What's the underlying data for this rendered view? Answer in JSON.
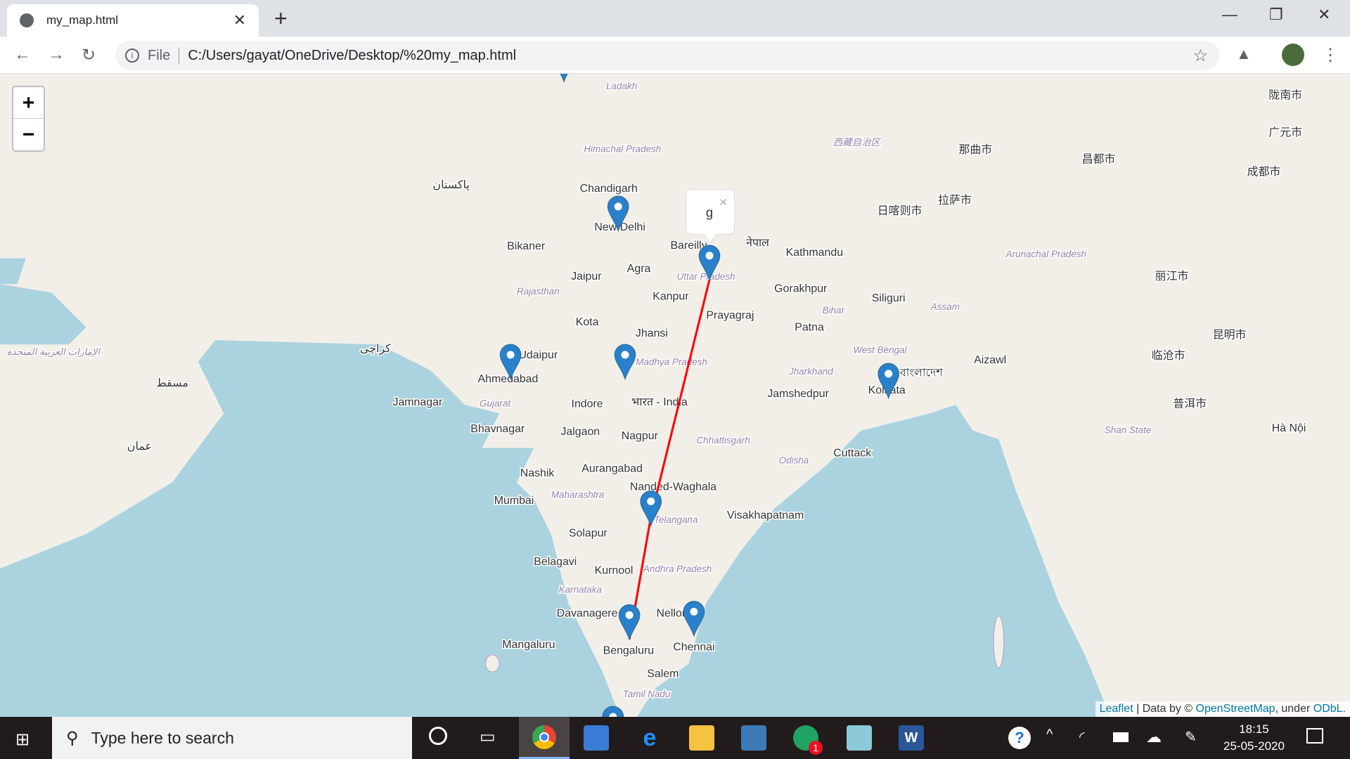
{
  "browser": {
    "tab_title": "my_map.html",
    "url_scheme": "File",
    "url": "C:/Users/gayat/OneDrive/Desktop/%20my_map.html"
  },
  "map": {
    "zoom_in": "+",
    "zoom_out": "−",
    "popup_text": "g",
    "popup_close": "×",
    "line_color": "#ff0000",
    "marker_color": "#2a81cb",
    "land_color": "#f2efe9",
    "water_color": "#aad3df",
    "attribution": {
      "leaflet": "Leaflet",
      "sep": " | Data by © ",
      "osm": "OpenStreetMap",
      "under": ", under ",
      "odbl": "ODbL."
    },
    "labels": [
      "Chandigarh",
      "New Delhi",
      "Bikaner",
      "Jaipur",
      "Agra",
      "Bareilly",
      "Uttar Pradesh",
      "Kanpur",
      "Prayagraj",
      "Gorakhpur",
      "Kathmandu",
      "Siliguri",
      "Patna",
      "Bihar",
      "Rajasthan",
      "Kota",
      "Jhansi",
      "Madhya Pradesh",
      "Udaipur",
      "Ahmedabad",
      "Jamnagar",
      "Gujarat",
      "Bhavnagar",
      "Indore",
      "भारत - India",
      "Jalgaon",
      "Nagpur",
      "Chhattisgarh",
      "Jharkhand",
      "Jamshedpur",
      "West Bengal",
      "Kolkata",
      "Odisha",
      "Cuttack",
      "Nashik",
      "Aurangabad",
      "Mumbai",
      "Maharashtra",
      "Nanded-Waghala",
      "Telangana",
      "Visakhapatnam",
      "Solapur",
      "Belagavi",
      "Kurnool",
      "Andhra Pradesh",
      "Karnataka",
      "Davanagere",
      "Nellore",
      "Mangaluru",
      "Bengaluru",
      "Chennai",
      "Salem",
      "Tamil Nadu",
      "Himachal Pradesh",
      "Ladakh",
      "Aizawl",
      "Arunachal Pradesh",
      "Assam",
      "拉萨市",
      "日喀则市",
      "那曲市",
      "昌都市",
      "西藏自治区",
      "成都市",
      "昆明市",
      "Hà Nội",
      "普洱市",
      "临沧市",
      "丽江市",
      "Shan State",
      "陇南市",
      "广元市",
      "کراچی",
      "پاکستان",
      "مسقط",
      "عمان",
      "الإمارات العربية المتحدة",
      "नेपाल",
      "বাংলাদেশ"
    ]
  },
  "taskbar": {
    "search_placeholder": "Type here to search",
    "time": "18:15",
    "date": "25-05-2020",
    "badge": "1"
  }
}
